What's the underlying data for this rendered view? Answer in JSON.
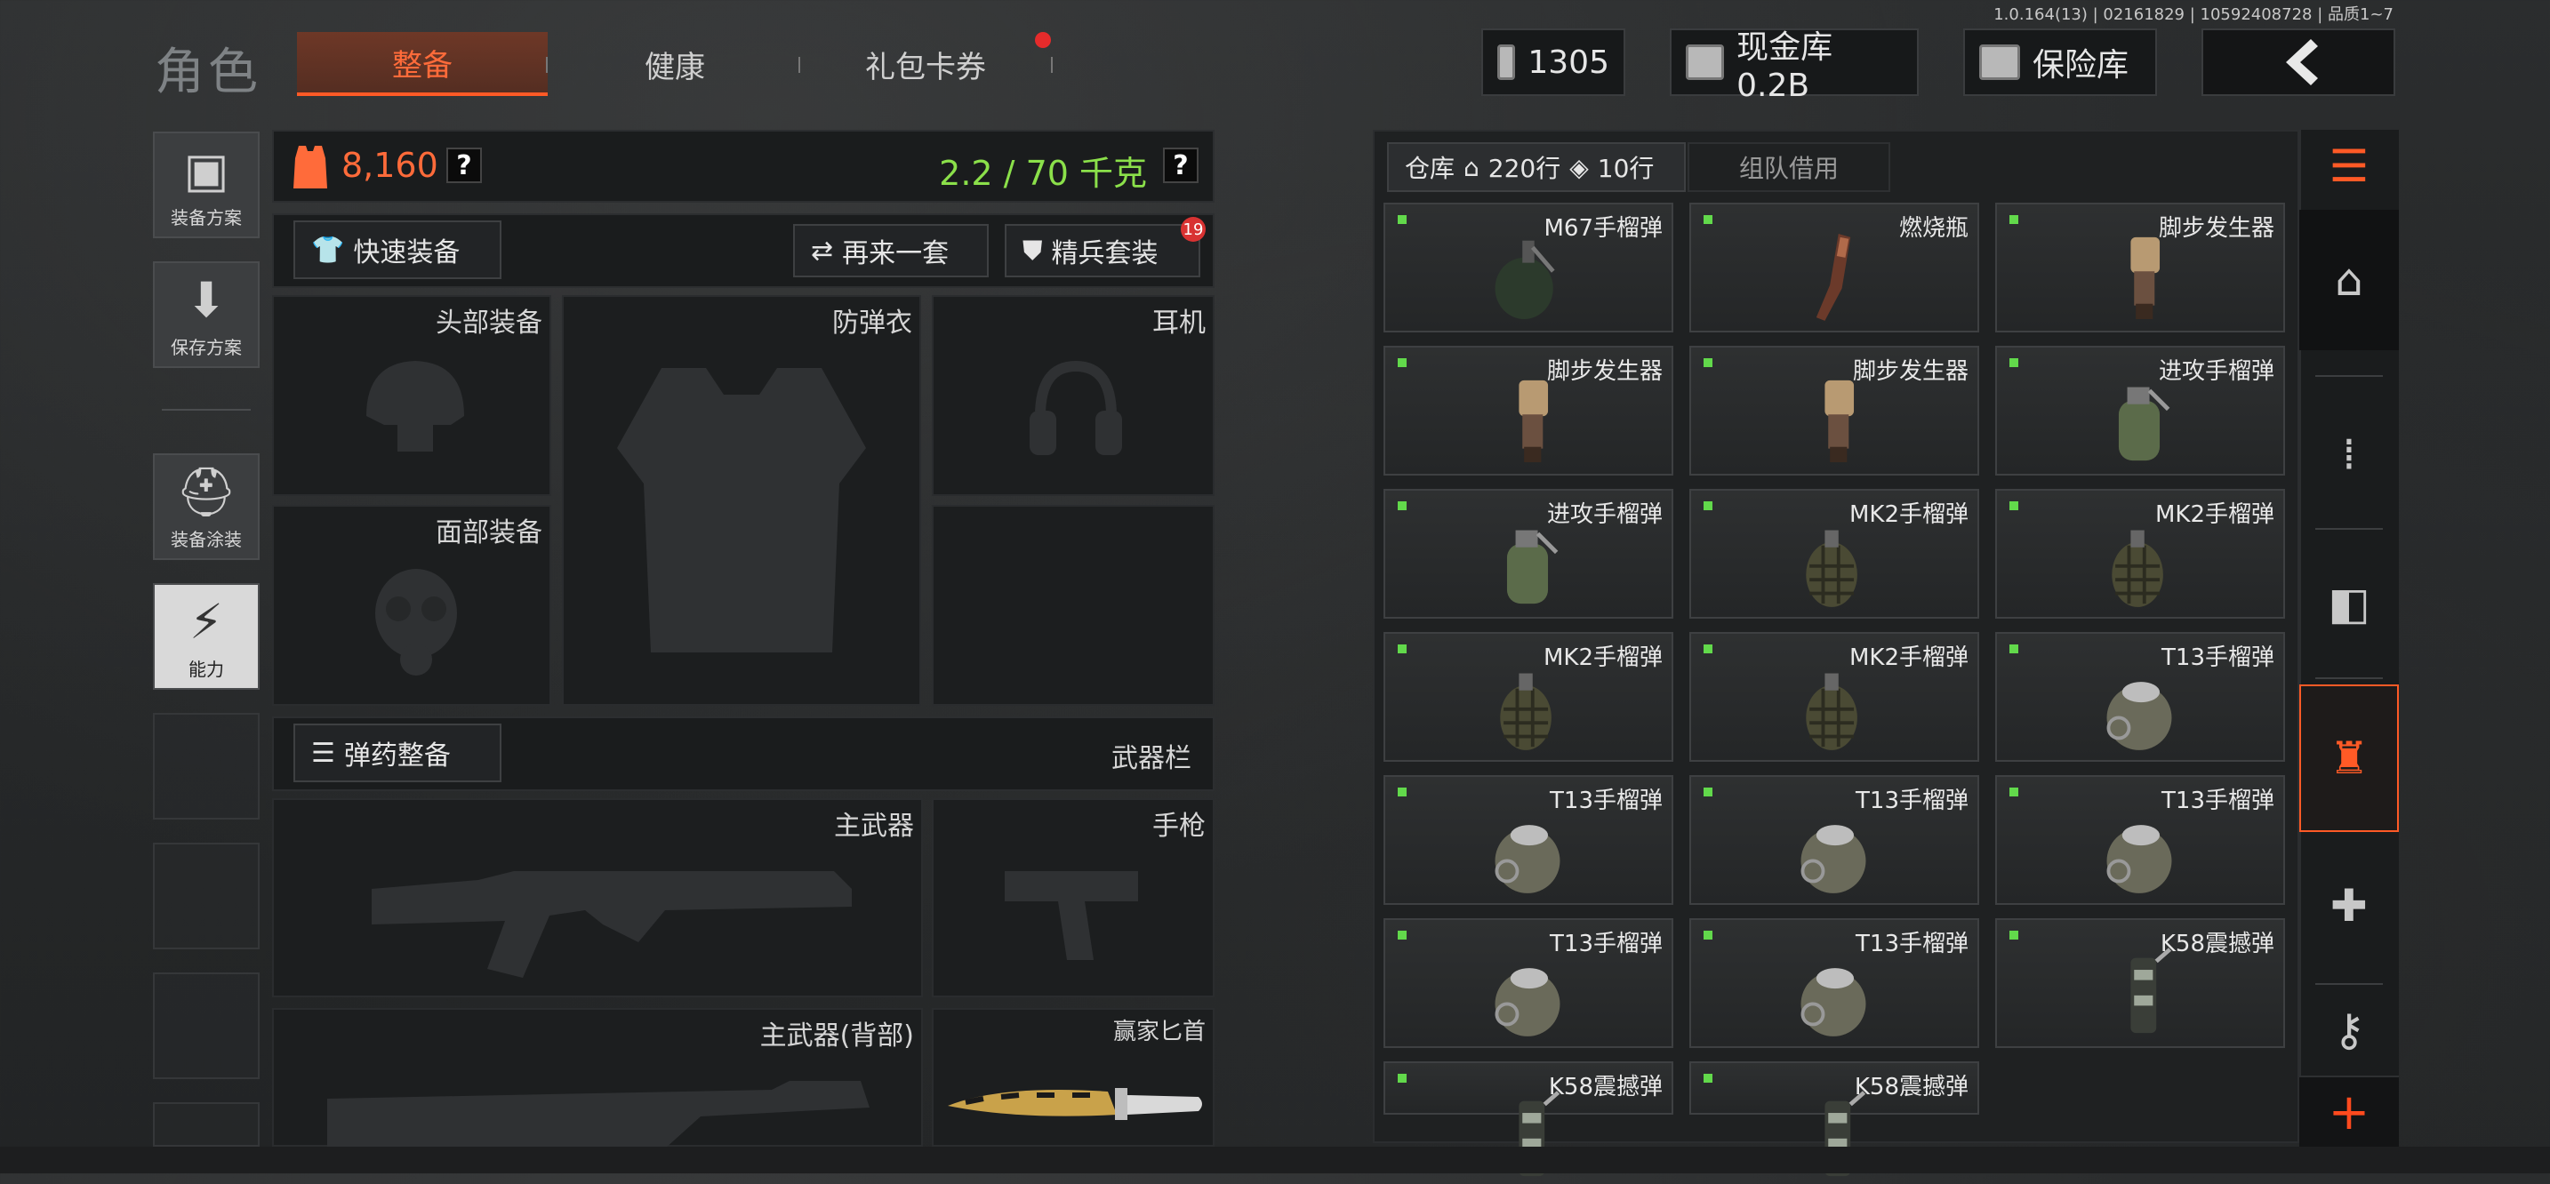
{
  "version": "1.0.164(13) | 02161829 | 10592408728 | 品质1~7",
  "title": "角色",
  "tabs": [
    {
      "label": "整备",
      "active": true
    },
    {
      "label": "健康",
      "active": false
    },
    {
      "label": "礼包卡券",
      "active": false
    }
  ],
  "currency": {
    "coupon": "1305",
    "cash": "现金库 0.2B",
    "vault": "保险库"
  },
  "sidebar": [
    {
      "label": "装备方案",
      "icon": "vest-icon"
    },
    {
      "label": "保存方案",
      "icon": "download-icon"
    },
    {
      "label": "装备涂装",
      "icon": "helmet-paint-icon"
    },
    {
      "label": "能力",
      "icon": "lightning-icon"
    }
  ],
  "equip": {
    "value": "8,160",
    "weight": "2.2 / 70 千克",
    "quick_equip": "快速装备",
    "again": "再来一套",
    "elite": "精兵套装",
    "elite_badge": "19",
    "slots": {
      "head": "头部装备",
      "armor": "防弹衣",
      "headset": "耳机",
      "face": "面部装备",
      "ammo": "弹药整备",
      "weapon_bar": "武器栏",
      "primary": "主武器",
      "pistol": "手枪",
      "primary_back": "主武器(背部)",
      "melee": "赢家匕首"
    }
  },
  "inventory": {
    "tab_storage": "仓库",
    "storage_rows": "220行",
    "tag_rows": "10行",
    "tab_team": "组队借用",
    "items": [
      {
        "name": "M67手榴弹",
        "kind": "round"
      },
      {
        "name": "燃烧瓶",
        "kind": "bottle"
      },
      {
        "name": "脚步发生器",
        "kind": "tube"
      },
      {
        "name": "脚步发生器",
        "kind": "tube"
      },
      {
        "name": "脚步发生器",
        "kind": "tube"
      },
      {
        "name": "进攻手榴弹",
        "kind": "can"
      },
      {
        "name": "进攻手榴弹",
        "kind": "can"
      },
      {
        "name": "MK2手榴弹",
        "kind": "pine"
      },
      {
        "name": "MK2手榴弹",
        "kind": "pine"
      },
      {
        "name": "MK2手榴弹",
        "kind": "pine"
      },
      {
        "name": "MK2手榴弹",
        "kind": "pine"
      },
      {
        "name": "T13手榴弹",
        "kind": "ball"
      },
      {
        "name": "T13手榴弹",
        "kind": "ball"
      },
      {
        "name": "T13手榴弹",
        "kind": "ball"
      },
      {
        "name": "T13手榴弹",
        "kind": "ball"
      },
      {
        "name": "T13手榴弹",
        "kind": "ball"
      },
      {
        "name": "T13手榴弹",
        "kind": "ball"
      },
      {
        "name": "K58震撼弹",
        "kind": "stun"
      },
      {
        "name": "K58震撼弹",
        "kind": "stun"
      },
      {
        "name": "K58震撼弹",
        "kind": "stun"
      }
    ]
  },
  "colors": {
    "accent": "#ff5a26",
    "weight_green": "#8be04a",
    "value_orange": "#ff6b3a"
  }
}
